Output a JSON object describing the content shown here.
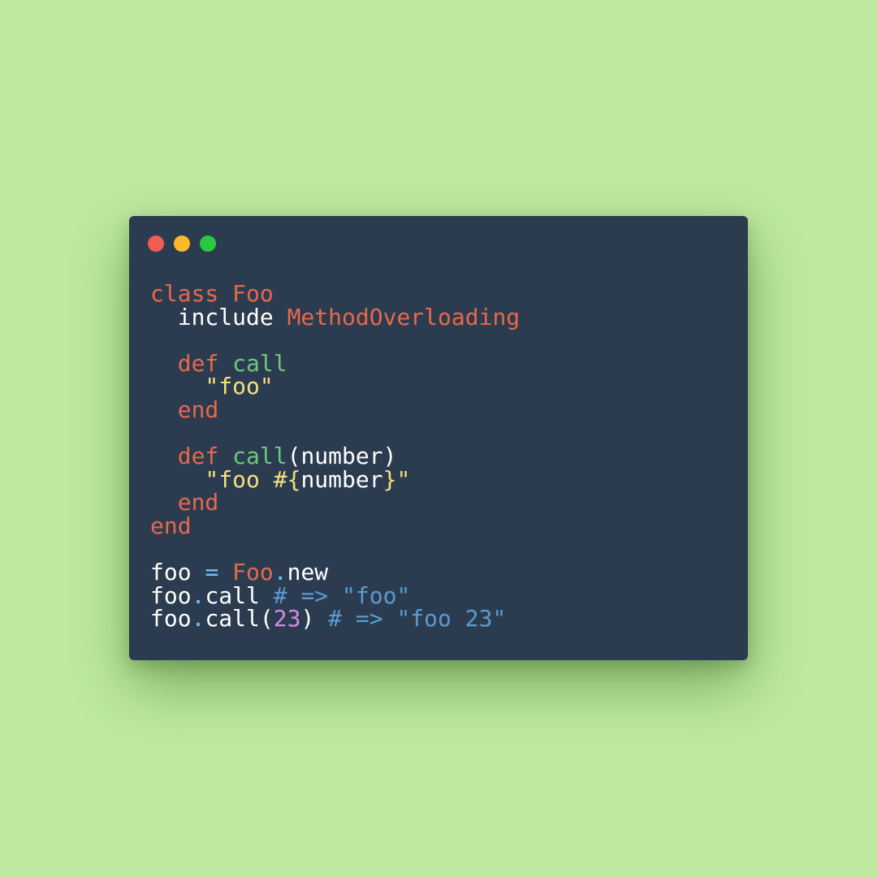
{
  "window": {
    "traffic_lights": [
      {
        "name": "close",
        "color": "#f15b52"
      },
      {
        "name": "minimize",
        "color": "#f9b92a"
      },
      {
        "name": "maximize",
        "color": "#2ac840"
      }
    ]
  },
  "code": {
    "language": "ruby",
    "lines": [
      [
        {
          "t": "class ",
          "c": "kw"
        },
        {
          "t": "Foo",
          "c": "const"
        }
      ],
      [
        {
          "t": "  include ",
          "c": "var"
        },
        {
          "t": "MethodOverloading",
          "c": "const"
        }
      ],
      [],
      [
        {
          "t": "  def ",
          "c": "kw"
        },
        {
          "t": "call",
          "c": "fn"
        }
      ],
      [
        {
          "t": "    \"foo\"",
          "c": "str"
        }
      ],
      [
        {
          "t": "  end",
          "c": "kw"
        }
      ],
      [],
      [
        {
          "t": "  def ",
          "c": "kw"
        },
        {
          "t": "call",
          "c": "fn"
        },
        {
          "t": "(number)",
          "c": "var"
        }
      ],
      [
        {
          "t": "    \"foo #{",
          "c": "str"
        },
        {
          "t": "number",
          "c": "var"
        },
        {
          "t": "}\"",
          "c": "str"
        }
      ],
      [
        {
          "t": "  end",
          "c": "kw"
        }
      ],
      [
        {
          "t": "end",
          "c": "kw"
        }
      ],
      [],
      [
        {
          "t": "foo ",
          "c": "var"
        },
        {
          "t": "= ",
          "c": "op"
        },
        {
          "t": "Foo",
          "c": "const"
        },
        {
          "t": ".",
          "c": "op"
        },
        {
          "t": "new",
          "c": "var"
        }
      ],
      [
        {
          "t": "foo",
          "c": "var"
        },
        {
          "t": ".",
          "c": "op"
        },
        {
          "t": "call ",
          "c": "var"
        },
        {
          "t": "# => \"foo\"",
          "c": "cmt"
        }
      ],
      [
        {
          "t": "foo",
          "c": "var"
        },
        {
          "t": ".",
          "c": "op"
        },
        {
          "t": "call(",
          "c": "var"
        },
        {
          "t": "23",
          "c": "num"
        },
        {
          "t": ") ",
          "c": "var"
        },
        {
          "t": "# => \"foo 23\"",
          "c": "cmt"
        }
      ]
    ]
  }
}
